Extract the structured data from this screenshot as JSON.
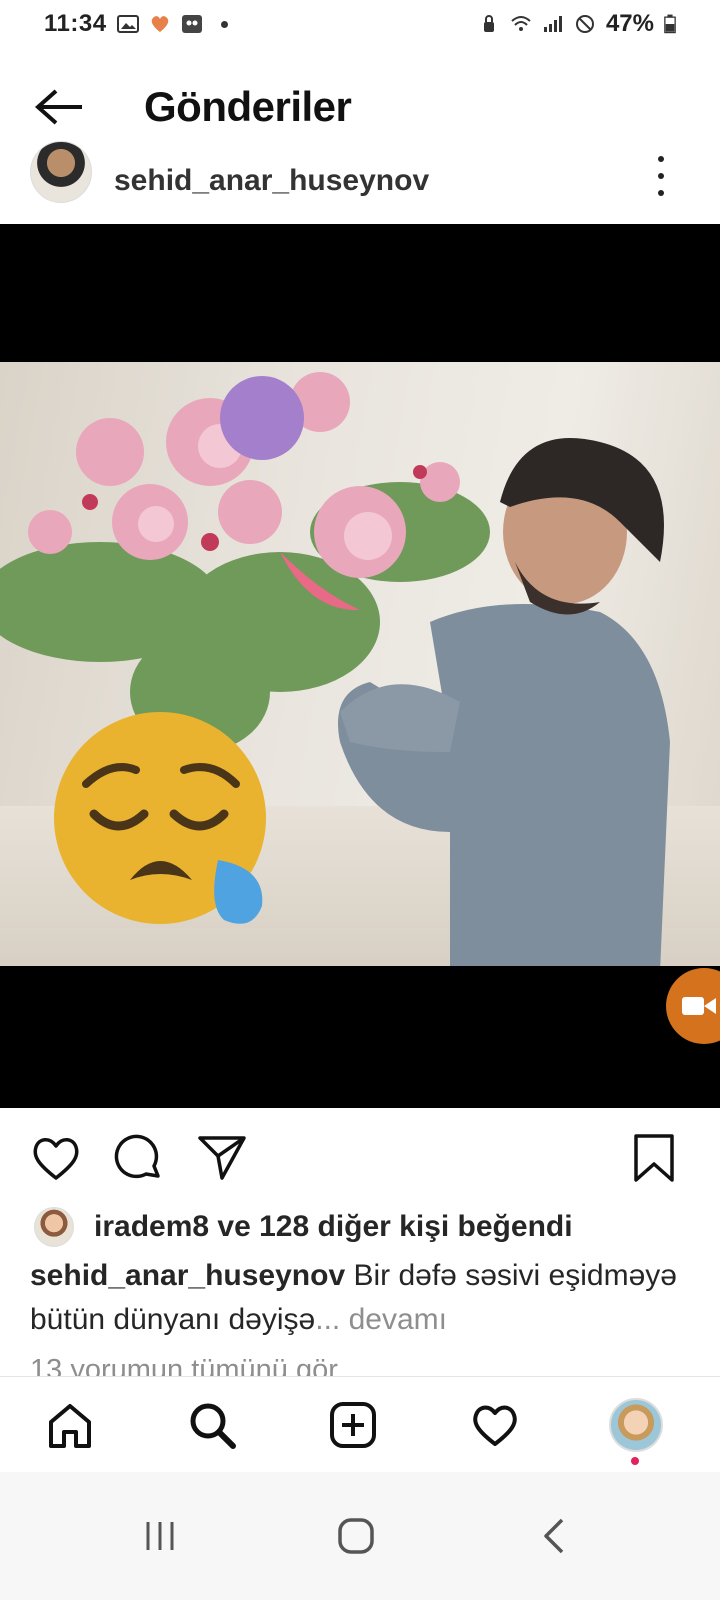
{
  "status_bar": {
    "time": "11:34",
    "battery_percent": "47%",
    "left_icons": [
      "image-icon",
      "health-icon",
      "app-icon",
      "dot-icon"
    ],
    "right_icons": [
      "lock-icon",
      "wifi-icon",
      "signal-icon",
      "dnd-icon",
      "battery-icon"
    ]
  },
  "header": {
    "title": "Gönderiler",
    "back_icon": "arrow-left-icon"
  },
  "post": {
    "author": "sehid_anar_huseynov",
    "media": {
      "type": "video",
      "description_icons": [
        "sad-emoji-sticker",
        "video-badge-icon"
      ]
    },
    "actions": {
      "like_icon": "heart-icon",
      "comment_icon": "comment-icon",
      "share_icon": "send-icon",
      "save_icon": "bookmark-icon"
    },
    "likes_text": "iradem8 ve 128 diğer kişi beğendi",
    "caption_user": "sehid_anar_huseynov",
    "caption_text": " Bir dəfə səsivi eşidməyə bütün dünyanı dəyişə",
    "caption_more": "... devamı",
    "comments_link": "13 yorumun tümünü gör"
  },
  "tab_bar": {
    "items": [
      "home-icon",
      "search-icon",
      "add-post-icon",
      "activity-heart-icon",
      "profile-avatar"
    ]
  },
  "nav_bar": {
    "items": [
      "recents-icon",
      "home-circle-icon",
      "back-chevron-icon"
    ]
  },
  "colors": {
    "background": "#ffffff",
    "text_primary": "#262626",
    "text_secondary": "#8e8e8e",
    "notification_dot": "#e0245e",
    "video_badge": "#d4721e"
  }
}
